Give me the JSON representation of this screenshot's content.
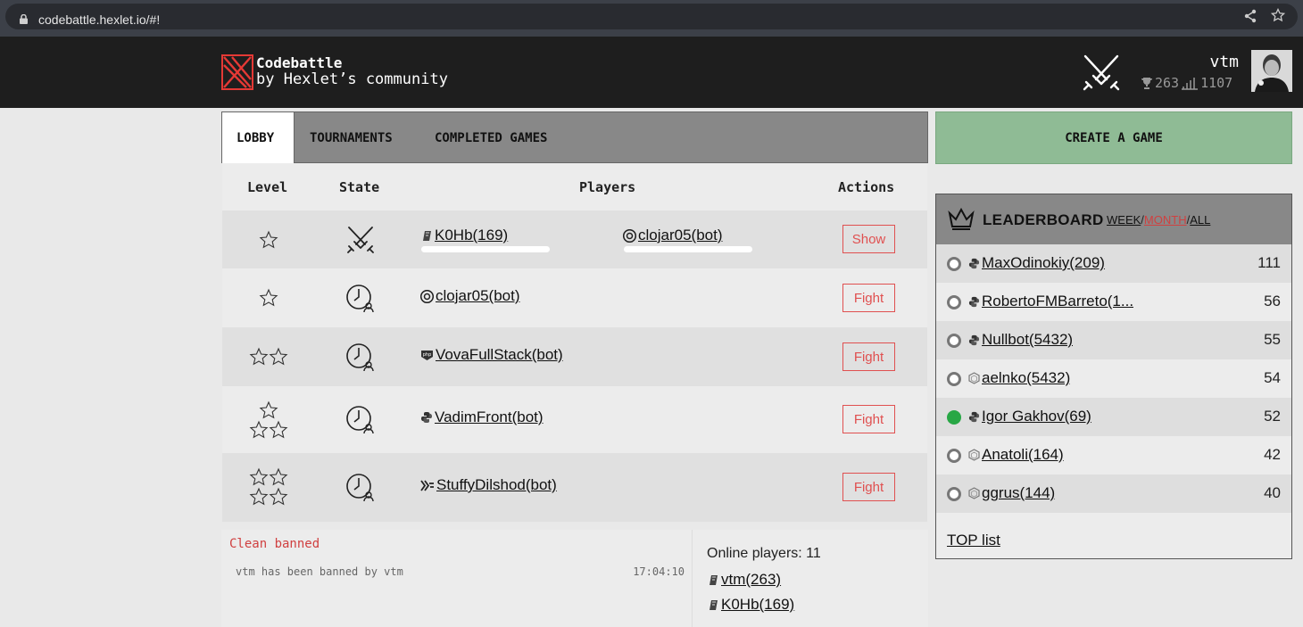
{
  "browser": {
    "url": "codebattle.hexlet.io/#!"
  },
  "header": {
    "brand_title": "Codebattle",
    "brand_subtitle": "by Hexlet’s community",
    "username": "vtm",
    "rank": "263",
    "rating": "1107"
  },
  "tabs": [
    {
      "label": "LOBBY",
      "active": true
    },
    {
      "label": "TOURNAMENTS",
      "active": false
    },
    {
      "label": "COMPLETED GAMES",
      "active": false
    }
  ],
  "table": {
    "headers": {
      "level": "Level",
      "state": "State",
      "players": "Players",
      "actions": "Actions"
    },
    "rows": [
      {
        "level_stars": 1,
        "state": "playing",
        "player1": "K0Hb(169)",
        "player1_lang": "elixir",
        "player2": "clojar05(bot)",
        "player2_lang": "clojure",
        "action": "Show"
      },
      {
        "level_stars": 1,
        "state": "waiting",
        "player1": "clojar05(bot)",
        "player1_lang": "clojure",
        "action": "Fight"
      },
      {
        "level_stars": 2,
        "state": "waiting",
        "player1": "VovaFullStack(bot)",
        "player1_lang": "php",
        "action": "Fight"
      },
      {
        "level_stars": 3,
        "state": "waiting",
        "player1": "VadimFront(bot)",
        "player1_lang": "python",
        "action": "Fight"
      },
      {
        "level_stars": 4,
        "state": "waiting",
        "player1": "StuffyDilshod(bot)",
        "player1_lang": "haskell",
        "action": "Fight"
      }
    ]
  },
  "chat": {
    "title": "Clean banned",
    "messages": [
      {
        "text": "vtm has been banned by vtm",
        "time": "17:04:10"
      }
    ]
  },
  "online": {
    "title": "Online players: 11",
    "players": [
      "vtm(263)",
      "K0Hb(169)"
    ]
  },
  "create_button": "CREATE A GAME",
  "leaderboard": {
    "title": "LEADERBOARD",
    "periods": [
      {
        "label": "WEEK",
        "active": false
      },
      {
        "label": "MONTH",
        "active": true
      },
      {
        "label": "ALL",
        "active": false
      }
    ],
    "rows": [
      {
        "name": "MaxOdinokiy(209)",
        "score": "111",
        "lang": "python",
        "online": false
      },
      {
        "name": "RobertoFMBarreto(1...",
        "score": "56",
        "lang": "python",
        "online": false
      },
      {
        "name": "Nullbot(5432)",
        "score": "55",
        "lang": "python",
        "online": false
      },
      {
        "name": "aelnko(5432)",
        "score": "54",
        "lang": "nodejs",
        "online": false
      },
      {
        "name": "Igor Gakhov(69)",
        "score": "52",
        "lang": "python",
        "online": true
      },
      {
        "name": "Anatoli(164)",
        "score": "42",
        "lang": "nodejs",
        "online": false
      },
      {
        "name": "ggrus(144)",
        "score": "40",
        "lang": "nodejs",
        "online": false
      }
    ],
    "top_list": "TOP list"
  },
  "colors": {
    "header_bg": "#1e1e1e",
    "create_btn": "#8fbb95",
    "action_red": "#e05050",
    "brand_red": "#e53935",
    "online_green": "#28a745"
  }
}
